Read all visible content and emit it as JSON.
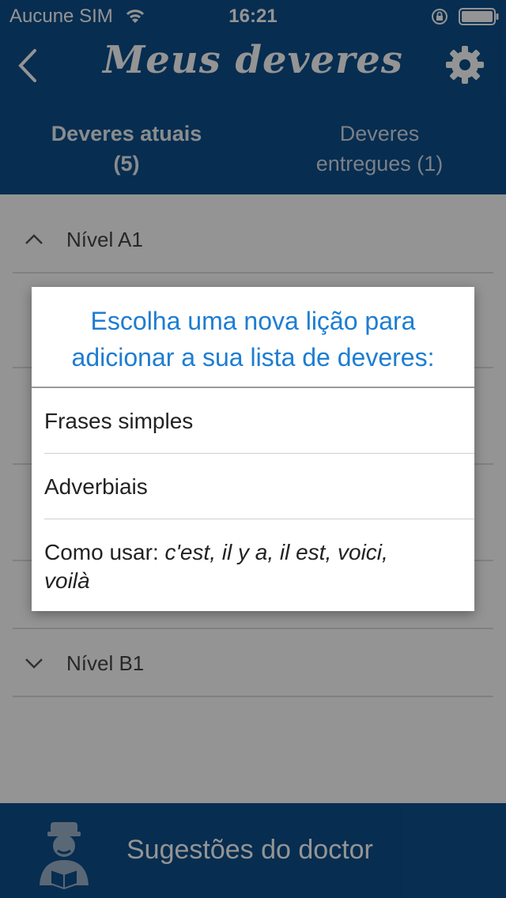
{
  "status_bar": {
    "carrier": "Aucune SIM",
    "time": "16:21"
  },
  "header": {
    "title": "Meus deveres",
    "back_icon": "chevron-left-icon",
    "settings_icon": "gear-icon"
  },
  "tabs": [
    {
      "line1": "Deveres atuais",
      "line2": "(5)",
      "active": true
    },
    {
      "line1": "Deveres",
      "line2": "entregues (1)",
      "active": false
    }
  ],
  "levels": [
    {
      "label": "Nível A1",
      "expanded": true
    },
    {
      "label": "Nível B1",
      "expanded": false
    }
  ],
  "dialog": {
    "title_line1": "Escolha uma nova lição para",
    "title_line2": "adicionar a sua lista de deveres:",
    "options": [
      {
        "label": "Frases simples"
      },
      {
        "label": "Adverbiais"
      },
      {
        "label_plain": "Como usar: ",
        "label_italic_1": "c'est, il y a, il est, voici,",
        "label_italic_2": "voilà"
      }
    ]
  },
  "bottom_bar": {
    "label": "Sugestões do doctor",
    "icon": "doctor-avatar-icon"
  },
  "colors": {
    "brand": "#0d4f8b",
    "dialog_title": "#1d7dd2"
  }
}
